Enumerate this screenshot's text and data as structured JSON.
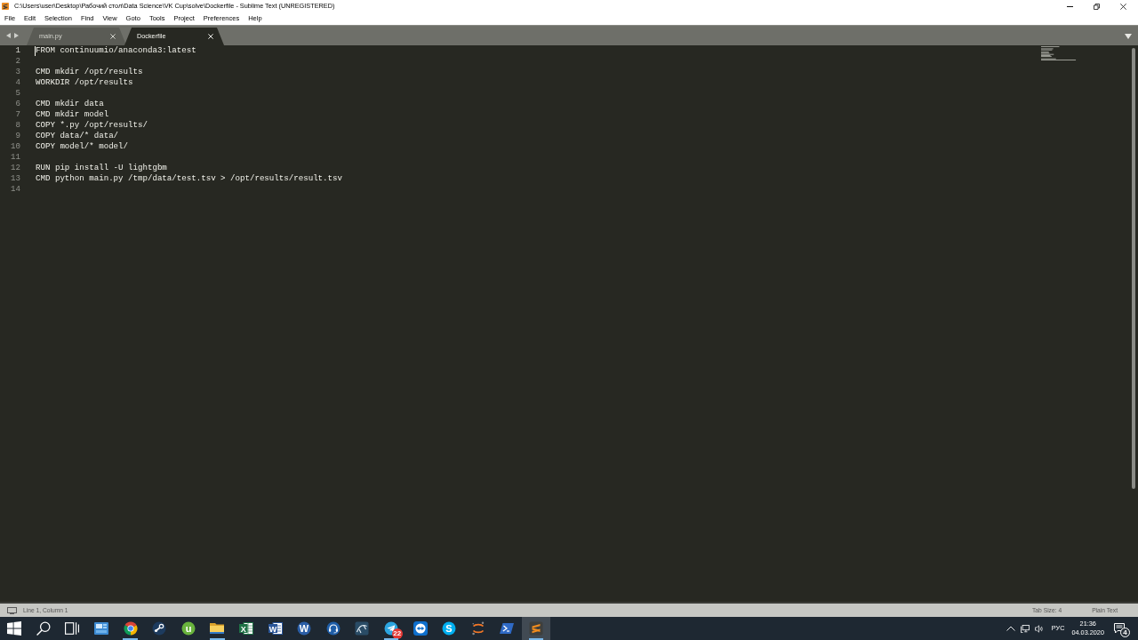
{
  "window": {
    "title": "C:\\Users\\user\\Desktop\\Рабочий стол\\Data Science\\VK Cup\\solve\\Dockerfile - Sublime Text (UNREGISTERED)"
  },
  "menu": [
    "File",
    "Edit",
    "Selection",
    "Find",
    "View",
    "Goto",
    "Tools",
    "Project",
    "Preferences",
    "Help"
  ],
  "tabs": [
    {
      "label": "main.py",
      "selected": false
    },
    {
      "label": "Dockerfile",
      "selected": true
    }
  ],
  "editor": {
    "lines": [
      {
        "number": "1",
        "text": "FROM continuumio/anaconda3:latest",
        "current": true
      },
      {
        "number": "2",
        "current": false
      },
      {
        "number": "3",
        "text": "CMD mkdir /opt/results",
        "current": false
      },
      {
        "number": "4",
        "text": "WORKDIR /opt/results",
        "current": false
      },
      {
        "number": "5",
        "current": false
      },
      {
        "number": "6",
        "text": "CMD mkdir data",
        "current": false
      },
      {
        "number": "7",
        "text": "CMD mkdir model",
        "current": false
      },
      {
        "number": "8",
        "text": "COPY *.py /opt/results/",
        "current": false
      },
      {
        "number": "9",
        "text": "COPY data/* data/",
        "current": false
      },
      {
        "number": "10",
        "text": "COPY model/* model/",
        "current": false
      },
      {
        "number": "11",
        "current": false
      },
      {
        "number": "12",
        "text": "RUN pip install -U lightgbm",
        "current": false
      },
      {
        "number": "13",
        "text": "CMD python main.py /tmp/data/test.tsv > /opt/results/result.tsv",
        "current": false
      },
      {
        "number": "14",
        "current": false
      }
    ]
  },
  "status_bar": {
    "position": "Line 1, Column 1",
    "tab_size": "Tab Size: 4",
    "syntax": "Plain Text"
  },
  "taskbar": {
    "buttons": [
      {
        "kind": "start",
        "running": false,
        "active": false
      },
      {
        "kind": "search",
        "running": false,
        "active": false
      },
      {
        "kind": "taskview",
        "running": false,
        "active": false
      },
      {
        "kind": "panel",
        "running": false,
        "active": false
      },
      {
        "kind": "browser",
        "running": true,
        "active": false
      },
      {
        "kind": "piston",
        "running": false,
        "active": false
      },
      {
        "kind": "ucircle",
        "glyph": "u",
        "running": false,
        "active": false
      },
      {
        "kind": "folder",
        "running": true,
        "active": false
      },
      {
        "kind": "sheet",
        "glyph": "X",
        "running": false,
        "active": false
      },
      {
        "kind": "doc",
        "glyph": "W",
        "running": false,
        "active": false
      },
      {
        "kind": "wcircle",
        "glyph": "W",
        "running": false,
        "active": false
      },
      {
        "kind": "headset",
        "running": false,
        "active": false
      },
      {
        "kind": "curve",
        "running": false,
        "active": false
      },
      {
        "kind": "plane",
        "badge": "22",
        "running": true,
        "active": false
      },
      {
        "kind": "arrows",
        "running": false,
        "active": false
      },
      {
        "kind": "scircle",
        "glyph": "S",
        "running": false,
        "active": false
      },
      {
        "kind": "orbit",
        "running": false,
        "active": false
      },
      {
        "kind": "prompt",
        "running": false,
        "active": false
      },
      {
        "kind": "stripes",
        "running": true,
        "active": true
      }
    ],
    "tray": {
      "language": "РУС",
      "time": "21:36",
      "date": "04.03.2020",
      "notifications": "4"
    }
  }
}
